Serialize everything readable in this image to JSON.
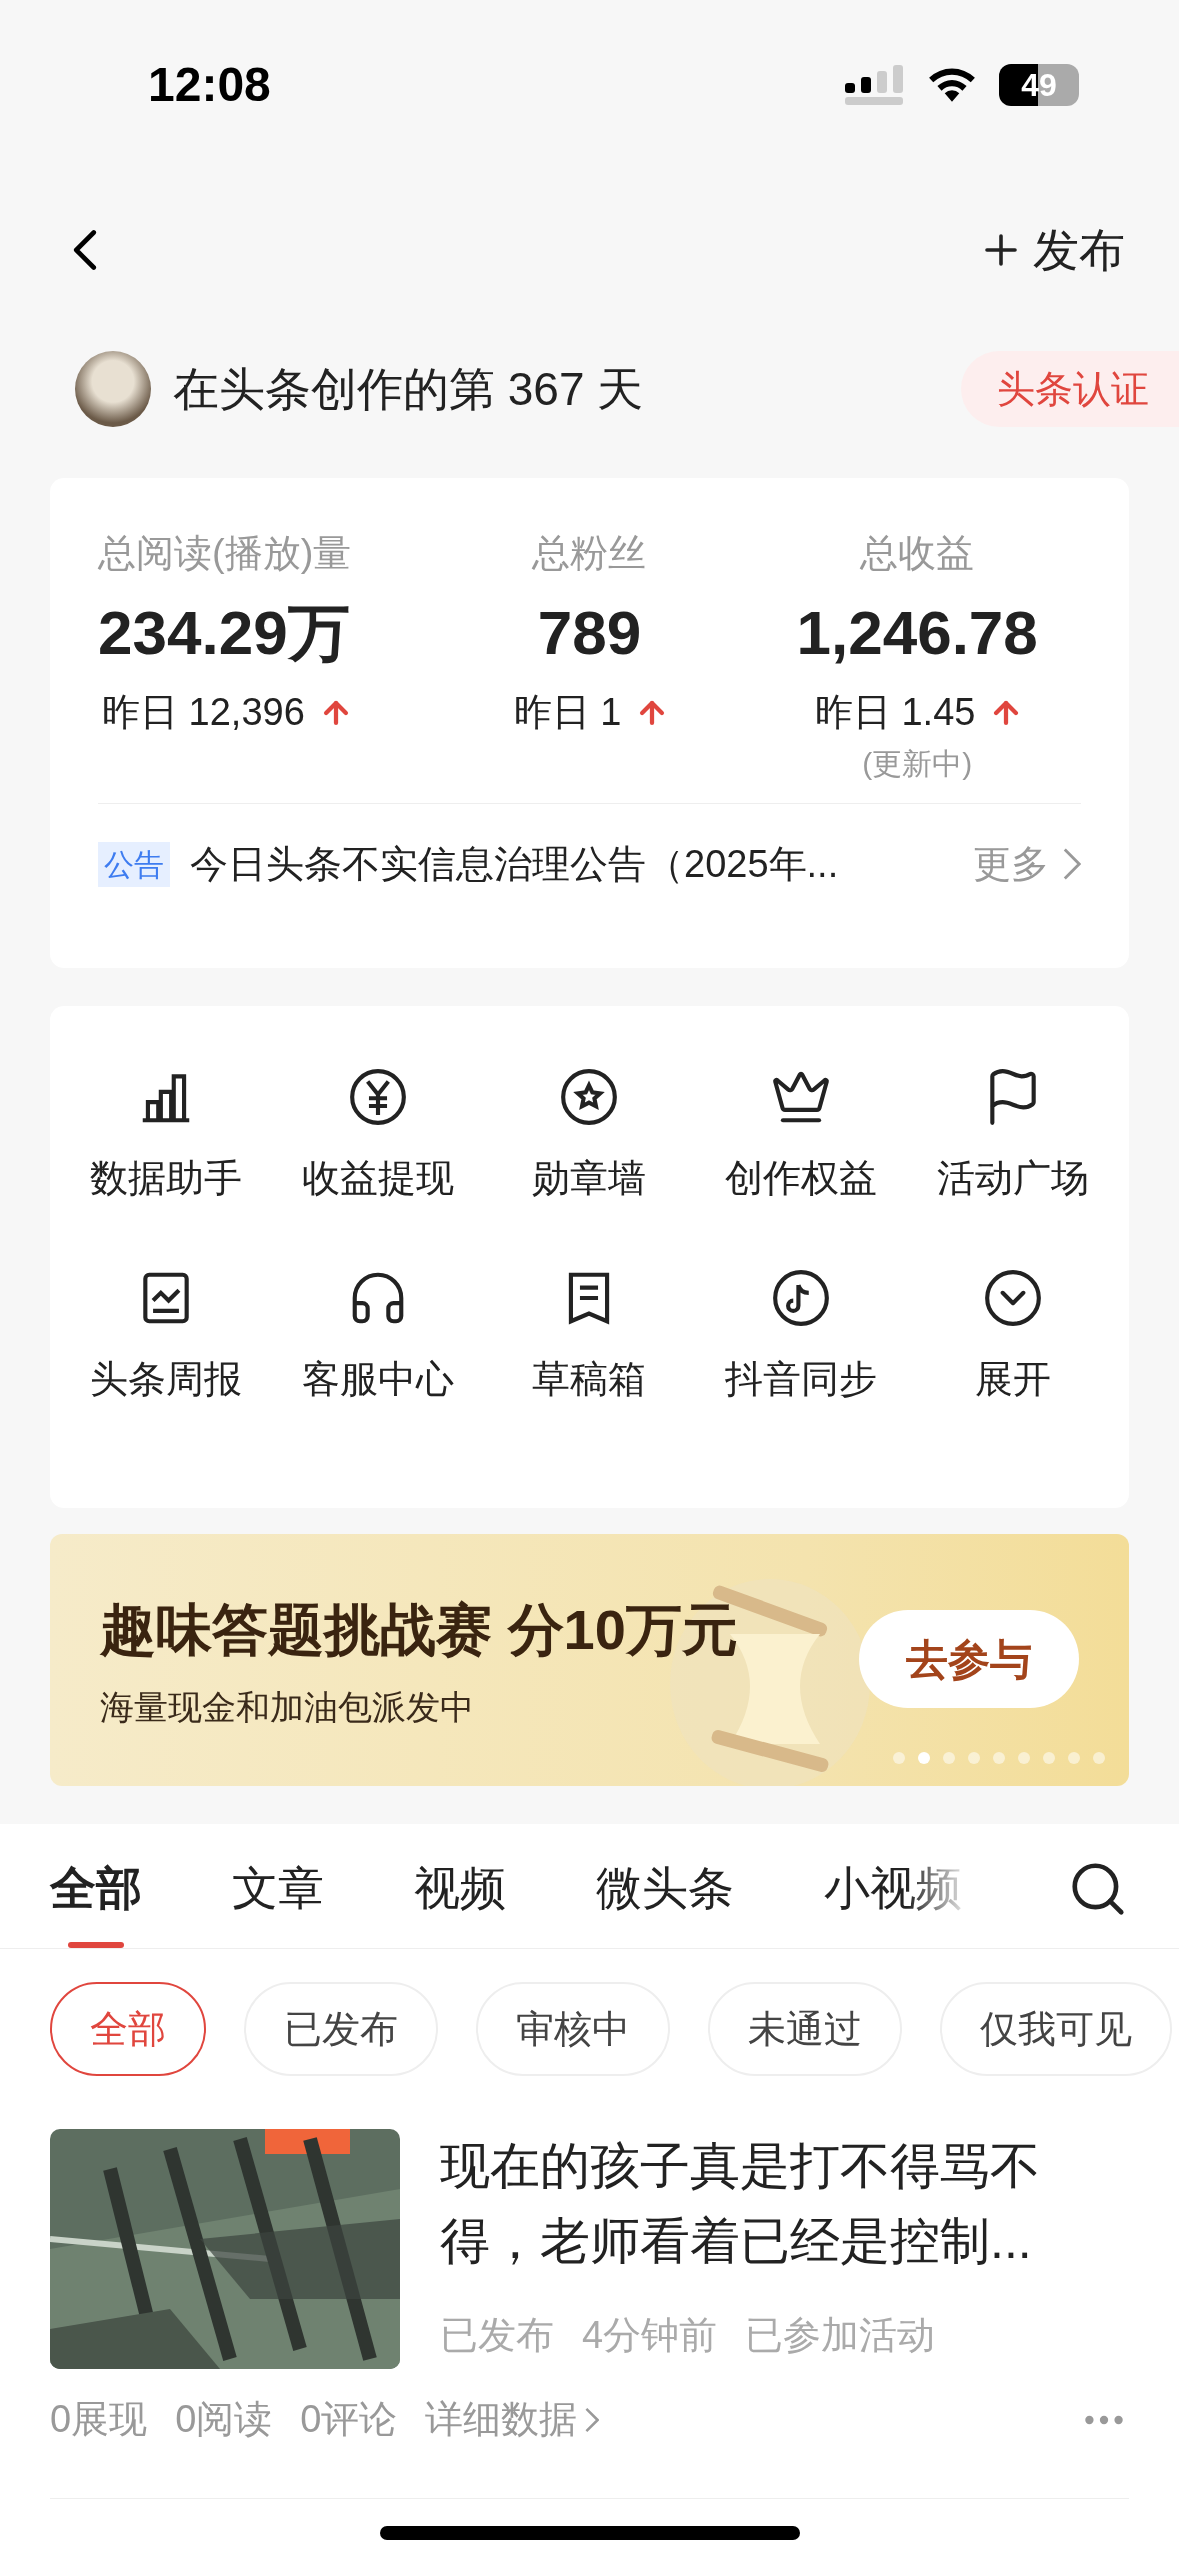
{
  "status_bar": {
    "time": "12:08",
    "battery": "49"
  },
  "nav": {
    "publish": "发布"
  },
  "profile": {
    "days_text": "在头条创作的第 367 天",
    "badge": "头条认证"
  },
  "stats": [
    {
      "label": "总阅读(播放)量",
      "value": "234.29万",
      "yesterday": "昨日 12,396"
    },
    {
      "label": "总粉丝",
      "value": "789",
      "yesterday": "昨日 1"
    },
    {
      "label": "总收益",
      "value": "1,246.78",
      "yesterday": "昨日 1.45",
      "note": "(更新中)"
    }
  ],
  "notice": {
    "tag": "公告",
    "text": "今日头条不实信息治理公告（2025年...",
    "more": "更多"
  },
  "tools": [
    {
      "label": "数据助手"
    },
    {
      "label": "收益提现"
    },
    {
      "label": "勋章墙"
    },
    {
      "label": "创作权益"
    },
    {
      "label": "活动广场"
    },
    {
      "label": "头条周报"
    },
    {
      "label": "客服中心"
    },
    {
      "label": "草稿箱"
    },
    {
      "label": "抖音同步"
    },
    {
      "label": "展开"
    }
  ],
  "banner": {
    "title": "趣味答题挑战赛 分10万元",
    "subtitle": "海量现金和加油包派发中",
    "button": "去参与",
    "pages": [
      {
        "selected": false
      },
      {
        "selected": true
      },
      {
        "selected": false
      },
      {
        "selected": false
      },
      {
        "selected": false
      },
      {
        "selected": false
      },
      {
        "selected": false
      },
      {
        "selected": false
      },
      {
        "selected": false
      }
    ]
  },
  "tabs": [
    {
      "label": "全部",
      "selected": true
    },
    {
      "label": "文章",
      "selected": false
    },
    {
      "label": "视频",
      "selected": false
    },
    {
      "label": "微头条",
      "selected": false
    },
    {
      "label": "小视频",
      "selected": false
    }
  ],
  "filters": [
    {
      "label": "全部",
      "selected": true
    },
    {
      "label": "已发布",
      "selected": false
    },
    {
      "label": "审核中",
      "selected": false
    },
    {
      "label": "未通过",
      "selected": false
    },
    {
      "label": "仅我可见",
      "selected": false
    }
  ],
  "articles": [
    {
      "kind": "picture",
      "title": "现在的孩子真是打不得骂不得，老师看着已经是控制...",
      "status": "已发布",
      "time": "4分钟前",
      "activity": "已参加活动",
      "stats": [
        "0展现",
        "0阅读",
        "0评论"
      ],
      "details": "详细数据"
    }
  ]
}
